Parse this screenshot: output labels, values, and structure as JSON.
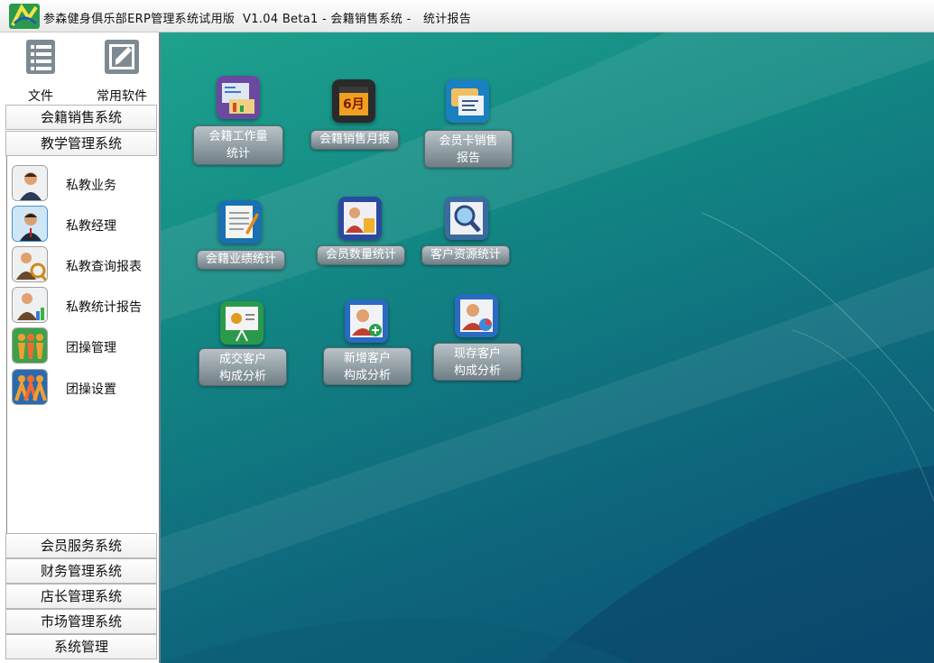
{
  "window": {
    "title": "参森健身俱乐部ERP管理系统试用版  V1.04 Beta1 - 会籍销售系统 -   统计报告"
  },
  "toolbar": {
    "file_label": "文件",
    "apps_label": "常用软件"
  },
  "sections_top": [
    {
      "label": "会籍销售系统"
    },
    {
      "label": "教学管理系统"
    }
  ],
  "menu": {
    "items": [
      {
        "label": "私教业务",
        "icon": "trainer-icon"
      },
      {
        "label": "私教经理",
        "icon": "manager-icon"
      },
      {
        "label": "私教查询报表",
        "icon": "search-report-icon"
      },
      {
        "label": "私教统计报告",
        "icon": "stats-report-icon"
      },
      {
        "label": "团操管理",
        "icon": "group-exercise-icon"
      },
      {
        "label": "团操设置",
        "icon": "group-settings-icon"
      }
    ]
  },
  "sections_bottom": [
    {
      "label": "会员服务系统"
    },
    {
      "label": "财务管理系统"
    },
    {
      "label": "店长管理系统"
    },
    {
      "label": "市场管理系统"
    },
    {
      "label": "系统管理"
    }
  ],
  "desktop": {
    "icons": [
      {
        "line1": "会籍工作量",
        "line2": "统计",
        "icon": "workload-icon"
      },
      {
        "line1": "会籍销售月报",
        "icon": "calendar-icon",
        "calendar_text": "6月"
      },
      {
        "line1": "会员卡销售",
        "line2": "报告",
        "icon": "card-sales-icon"
      },
      {
        "line1": "会籍业绩统计",
        "icon": "notepad-icon"
      },
      {
        "line1": "会员数量统计",
        "icon": "members-count-icon"
      },
      {
        "line1": "客户资源统计",
        "icon": "magnifier-icon"
      },
      {
        "line1": "成交客户",
        "line2": "构成分析",
        "icon": "presentation-icon"
      },
      {
        "line1": "新增客户",
        "line2": "构成分析",
        "icon": "new-customer-icon"
      },
      {
        "line1": "现存客户",
        "line2": "构成分析",
        "icon": "existing-customer-icon"
      }
    ]
  },
  "colors": {
    "desktop_top": "#1ea28e",
    "desktop_bottom": "#0b4f73",
    "label_bg": "#8d9aa0"
  }
}
